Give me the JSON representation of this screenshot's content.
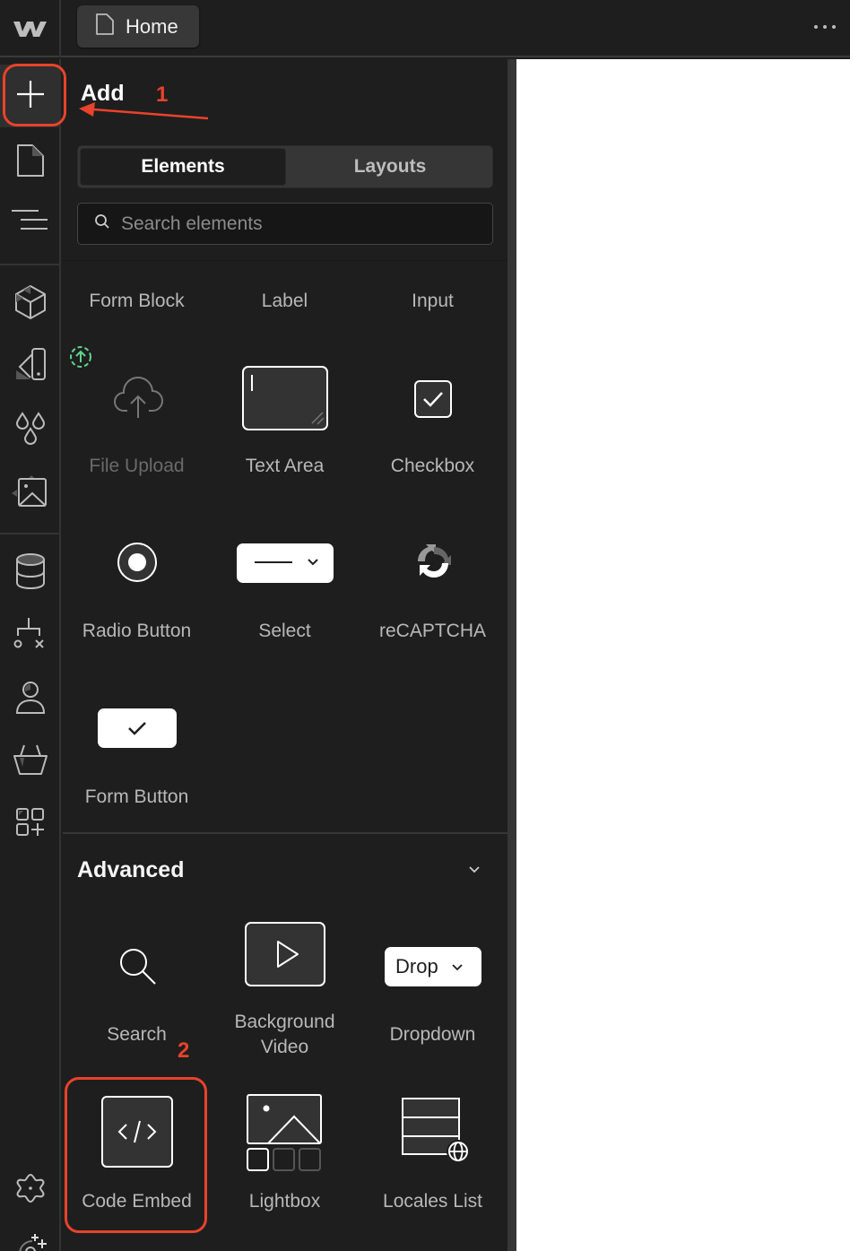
{
  "topbar": {
    "logo": "webflow-logo",
    "page_button_label": "Home",
    "page_icon": "page-icon",
    "more_icon": "more-horizontal-icon"
  },
  "rail": {
    "items": [
      {
        "name": "add",
        "icon": "plus-icon",
        "active": true
      },
      {
        "name": "pages",
        "icon": "page-icon"
      },
      {
        "name": "navigator",
        "icon": "navigator-icon"
      },
      {
        "name": "components",
        "icon": "cube-icon"
      },
      {
        "name": "style-selectors",
        "icon": "swatch-icon"
      },
      {
        "name": "variables",
        "icon": "drops-icon"
      },
      {
        "name": "assets",
        "icon": "image-icon"
      },
      {
        "name": "cms",
        "icon": "database-icon"
      },
      {
        "name": "logic",
        "icon": "flow-icon"
      },
      {
        "name": "users",
        "icon": "user-icon"
      },
      {
        "name": "ecommerce",
        "icon": "basket-icon"
      },
      {
        "name": "apps",
        "icon": "apps-icon"
      },
      {
        "name": "settings",
        "icon": "settings-gear-icon"
      },
      {
        "name": "collaborators",
        "icon": "add-collaborator-icon"
      }
    ]
  },
  "panel": {
    "title": "Add",
    "tabs": [
      {
        "label": "Elements",
        "active": true
      },
      {
        "label": "Layouts",
        "active": false
      }
    ],
    "search": {
      "placeholder": "Search elements",
      "value": ""
    },
    "forms": {
      "top_row": [
        "Form Block",
        "Label",
        "Input"
      ],
      "items": [
        {
          "label": "File Upload",
          "icon": "cloud-upload-icon",
          "disabled": true,
          "badge": "upgrade-upload-badge-icon"
        },
        {
          "label": "Text Area",
          "icon": "textarea-icon"
        },
        {
          "label": "Checkbox",
          "icon": "checkbox-icon"
        },
        {
          "label": "Radio Button",
          "icon": "radio-button-icon"
        },
        {
          "label": "Select",
          "icon": "select-icon"
        },
        {
          "label": "reCAPTCHA",
          "icon": "recaptcha-icon"
        },
        {
          "label": "Form Button",
          "icon": "form-button-icon"
        }
      ]
    },
    "advanced": {
      "title": "Advanced",
      "expanded": true,
      "items": [
        {
          "label": "Search",
          "icon": "search-element-icon"
        },
        {
          "label": "Background\nVideo",
          "label_line1": "Background",
          "label_line2": "Video",
          "icon": "background-video-icon"
        },
        {
          "label": "Dropdown",
          "icon": "dropdown-icon",
          "icon_text": "Drop"
        },
        {
          "label": "Code Embed",
          "icon": "code-embed-icon"
        },
        {
          "label": "Lightbox",
          "icon": "lightbox-icon"
        },
        {
          "label": "Locales List",
          "icon": "locales-list-icon"
        }
      ]
    }
  },
  "annotations": {
    "step1": "1",
    "step2": "2",
    "color": "#e8432b"
  },
  "colors": {
    "background": "#1e1e1e",
    "accent_annotation": "#e8432b",
    "badge_green": "#5fd38d",
    "canvas": "#ffffff"
  }
}
